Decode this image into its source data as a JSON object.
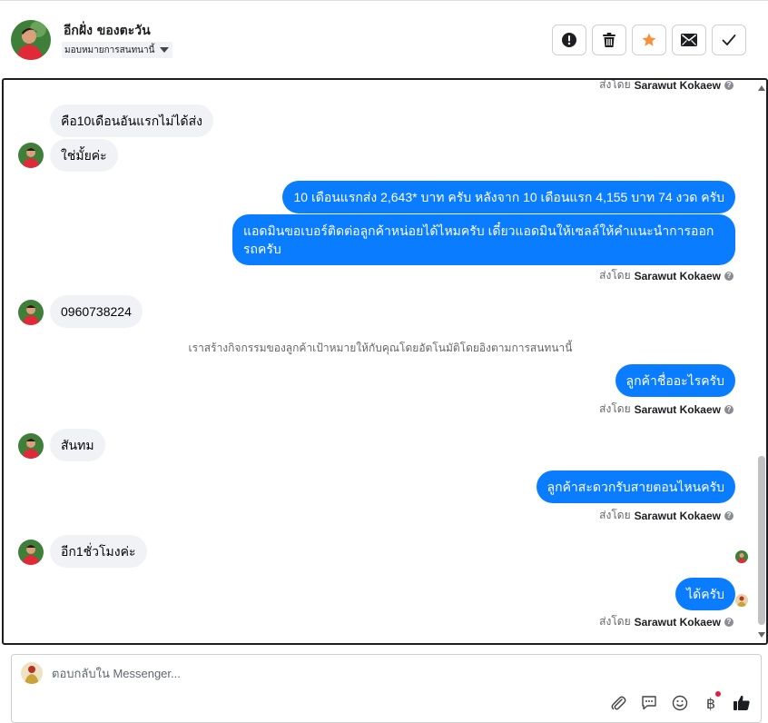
{
  "header": {
    "contact_name": "อีกฝั่ง ของตะวัน",
    "assign_label": "มอบหมายการสนทนานี้",
    "actions": [
      {
        "name": "mark-spam-button",
        "icon": "exclamation-icon"
      },
      {
        "name": "delete-button",
        "icon": "trash-icon"
      },
      {
        "name": "star-button",
        "icon": "star-icon",
        "color": "#f7923b"
      },
      {
        "name": "mark-unread-button",
        "icon": "envelope-icon"
      },
      {
        "name": "mark-done-button",
        "icon": "check-icon"
      }
    ]
  },
  "conversation": {
    "sent_by_prefix": "ส่งโดย",
    "agent_name": "Sarawut Kokaew",
    "messages": [
      {
        "direction": "in",
        "text": "คือ10เดือนอันแรกไม่ได้ส่ง"
      },
      {
        "direction": "in",
        "text": "ใช่มั้ยค่ะ"
      },
      {
        "direction": "out",
        "text": "10 เดือนแรกส่ง 2,643* บาท ครับ หลังจาก 10 เดือนแรก  4,155  บาท 74 งวด ครับ"
      },
      {
        "direction": "out",
        "text": "แอดมินขอเบอร์ติดต่อลูกค้าหน่อยได้ไหมครับ เดี๋ยวแอดมินให้เซลล์ให้คำแนะนำการออกรถครับ"
      },
      {
        "direction": "in",
        "text": "0960738224"
      },
      {
        "direction": "out",
        "text": "ลูกค้าชื่ออะไรครับ"
      },
      {
        "direction": "in",
        "text": "สันทม"
      },
      {
        "direction": "out",
        "text": "ลูกค้าสะดวกรับสายตอนไหนครับ"
      },
      {
        "direction": "in",
        "text": "อีก1ชั่วโมงค่ะ"
      },
      {
        "direction": "out",
        "text": "ได้ครับ"
      }
    ],
    "system_note": "เราสร้างกิจกรรมของลูกค้าเป้าหมายให้กับคุณโดยอัตโนมัติโดยอิงตามการสนทนานี้"
  },
  "reply": {
    "placeholder": "ตอบกลับใน Messenger...",
    "tools": [
      "attach-icon",
      "saved-replies-icon",
      "emoji-icon",
      "payment-baht-icon",
      "like-icon"
    ],
    "baht_symbol": "฿"
  },
  "colors": {
    "outgoing_bubble": "#0a7cff",
    "incoming_bubble": "#f0f2f5",
    "accent_star": "#f7923b"
  }
}
